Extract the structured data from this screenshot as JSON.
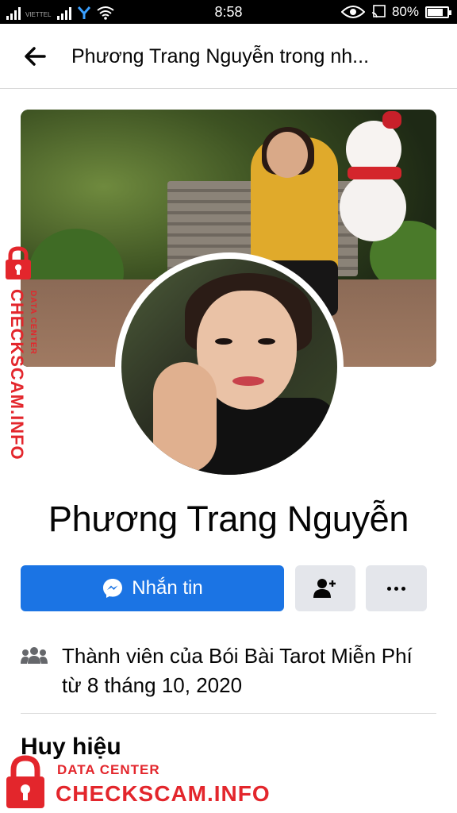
{
  "status_bar": {
    "time": "8:58",
    "battery_text": "80%",
    "battery_level": 0.8,
    "carrier": "VIETTEL"
  },
  "header": {
    "title": "Phương Trang Nguyễn trong nh..."
  },
  "profile": {
    "name": "Phương Trang Nguyễn"
  },
  "actions": {
    "message_label": "Nhắn tin"
  },
  "member_info": {
    "text": "Thành viên của Bói Bài Tarot Miễn Phí từ 8 tháng 10, 2020"
  },
  "sections": {
    "badges_title": "Huy hiệu"
  },
  "watermark": {
    "side_main": "CHECKSCAM.INFO",
    "side_sub": "DATA CENTER",
    "bottom_sub": "DATA CENTER",
    "bottom_main": "CHECKSCAM.INFO"
  },
  "colors": {
    "primary_button": "#1b74e4",
    "secondary_button": "#e4e6eb",
    "watermark_red": "#e3262c"
  },
  "icons": [
    "back-arrow-icon",
    "messenger-icon",
    "add-friend-icon",
    "more-dots-icon",
    "group-members-icon",
    "lock-icon",
    "wifi-icon",
    "eye-icon",
    "signal-icon",
    "battery-icon"
  ]
}
